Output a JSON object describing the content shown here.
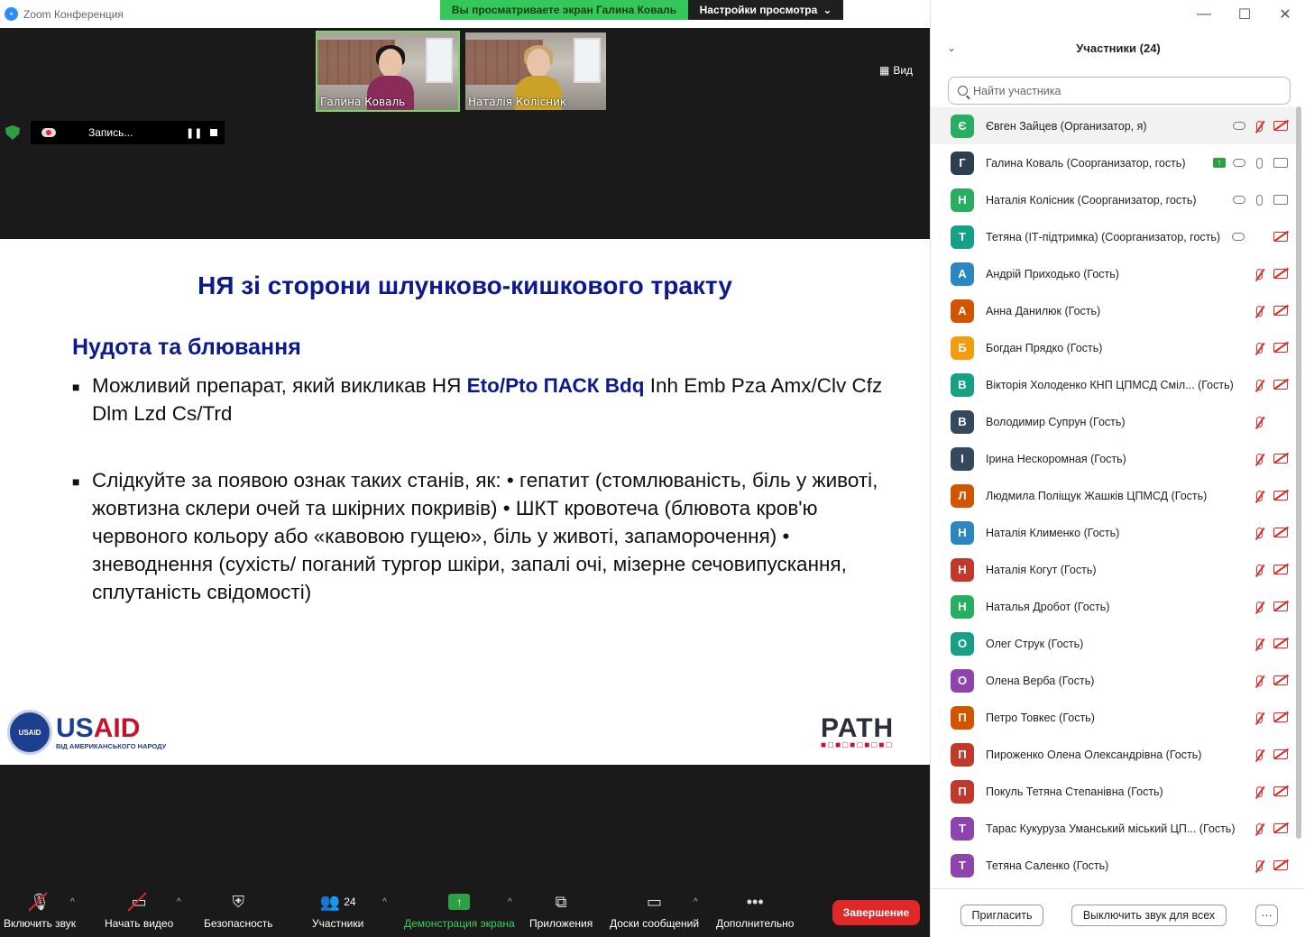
{
  "window": {
    "title": "Zoom Конференция"
  },
  "banner": {
    "sharing": "Вы просматриваете экран Галина Коваль",
    "view_settings": "Настройки просмотра"
  },
  "video": {
    "view_label": "Вид",
    "thumbs": [
      {
        "name": "Галина Коваль"
      },
      {
        "name": "Наталія Колісник"
      }
    ],
    "recording": {
      "label": "Запись..."
    }
  },
  "slide": {
    "title": "НЯ зі сторони шлунково-кишкового тракту",
    "subtitle": "Нудота та блювання",
    "bullet1_a": "Можливий препарат, який викликав НЯ ",
    "bullet1_b": "Eto/Pto ПАСК Bdq",
    "bullet1_c": " Inh Emb Pza Amx/Clv Cfz Dlm Lzd Cs/Trd",
    "bullet2": "Слідкуйте за появою ознак таких станів, як: • гепатит (стомлюваність, біль у животі, жовтизна склери очей та шкірних покривів) • ШКТ кровотеча (блювота кров'ю червоного кольору або «кавовою гущею», біль у животі, запаморочення) • зневоднення (сухість/ поганий тургор шкіри, запалі очі, мізерне сечовипускання, сплутаність свідомості)",
    "usaid_word_a": "US",
    "usaid_word_b": "AID",
    "usaid_seal": "USAID",
    "usaid_tagline": "ВІД АМЕРИКАНСЬКОГО НАРОДУ",
    "path_logo": "PATH"
  },
  "toolbar": {
    "unmute": "Включить звук",
    "start_video": "Начать видео",
    "security": "Безопасность",
    "participants": "Участники",
    "participants_count": "24",
    "share": "Демонстрация экрана",
    "apps": "Приложения",
    "whiteboards": "Доски сообщений",
    "more": "Дополнительно",
    "end": "Завершение"
  },
  "panel": {
    "title": "Участники (24)",
    "search_placeholder": "Найти участника",
    "invite": "Пригласить",
    "mute_all": "Выключить звук для всех",
    "more": "···",
    "participants": [
      {
        "initial": "Є",
        "color": "#27ae60",
        "name": "Євген Зайцев (Организатор, я)",
        "cloud": true,
        "share": false,
        "mic": "off",
        "cam": "off"
      },
      {
        "initial": "Г",
        "color": "#2c3e50",
        "name": "Галина Коваль (Соорганизатор, гость)",
        "cloud": true,
        "share": true,
        "mic": "on",
        "cam": "on"
      },
      {
        "initial": "Н",
        "color": "#27ae60",
        "name": "Наталія Колісник (Соорганизатор, гость)",
        "cloud": true,
        "share": false,
        "mic": "on",
        "cam": "on"
      },
      {
        "initial": "Т",
        "color": "#16a085",
        "name": "Тетяна (ІТ-підтримка) (Соорганизатор, гость)",
        "cloud": true,
        "share": false,
        "mic": "none",
        "cam": "off"
      },
      {
        "initial": "А",
        "color": "#2e86c1",
        "name": "Андрій Приходько (Гость)",
        "cloud": false,
        "share": false,
        "mic": "off",
        "cam": "off"
      },
      {
        "initial": "А",
        "color": "#d35400",
        "name": "Анна Данилюк (Гость)",
        "cloud": false,
        "share": false,
        "mic": "off",
        "cam": "off"
      },
      {
        "initial": "Б",
        "color": "#f39c12",
        "name": "Богдан Прядко (Гость)",
        "cloud": false,
        "share": false,
        "mic": "off",
        "cam": "off"
      },
      {
        "initial": "В",
        "color": "#16a085",
        "name": "Вікторія Холоденко КНП ЦПМСД Сміл... (Гость)",
        "cloud": false,
        "share": false,
        "mic": "off",
        "cam": "off"
      },
      {
        "initial": "В",
        "color": "#34495e",
        "name": "Володимир Супрун (Гость)",
        "cloud": false,
        "share": false,
        "mic": "off",
        "cam": "none"
      },
      {
        "initial": "І",
        "color": "#34495e",
        "name": "Ірина Нескоромная (Гость)",
        "cloud": false,
        "share": false,
        "mic": "off",
        "cam": "off"
      },
      {
        "initial": "Л",
        "color": "#d35400",
        "name": "Людмила Поліщук Жашків ЦПМСД (Гость)",
        "cloud": false,
        "share": false,
        "mic": "off",
        "cam": "off"
      },
      {
        "initial": "Н",
        "color": "#2e86c1",
        "name": "Наталія Клименко (Гость)",
        "cloud": false,
        "share": false,
        "mic": "off",
        "cam": "off"
      },
      {
        "initial": "Н",
        "color": "#c0392b",
        "name": "Наталія Когут (Гость)",
        "cloud": false,
        "share": false,
        "mic": "off",
        "cam": "off"
      },
      {
        "initial": "Н",
        "color": "#27ae60",
        "name": "Наталья Дробот (Гость)",
        "cloud": false,
        "share": false,
        "mic": "off",
        "cam": "off"
      },
      {
        "initial": "О",
        "color": "#16a085",
        "name": "Олег Струк (Гость)",
        "cloud": false,
        "share": false,
        "mic": "off",
        "cam": "off"
      },
      {
        "initial": "О",
        "color": "#8e44ad",
        "name": "Олена Верба (Гость)",
        "cloud": false,
        "share": false,
        "mic": "off",
        "cam": "off"
      },
      {
        "initial": "П",
        "color": "#d35400",
        "name": "Петро Товкес (Гость)",
        "cloud": false,
        "share": false,
        "mic": "off",
        "cam": "off"
      },
      {
        "initial": "П",
        "color": "#c0392b",
        "name": "Пироженко Олена Олександрівна (Гость)",
        "cloud": false,
        "share": false,
        "mic": "off",
        "cam": "off"
      },
      {
        "initial": "П",
        "color": "#c0392b",
        "name": "Покуль Тетяна Степанівна (Гость)",
        "cloud": false,
        "share": false,
        "mic": "off",
        "cam": "off"
      },
      {
        "initial": "Т",
        "color": "#8e44ad",
        "name": "Тарас Кукуруза Уманський міський ЦП... (Гость)",
        "cloud": false,
        "share": false,
        "mic": "off",
        "cam": "off"
      },
      {
        "initial": "Т",
        "color": "#8e44ad",
        "name": "Тетяна Саленко (Гость)",
        "cloud": false,
        "share": false,
        "mic": "off",
        "cam": "off"
      }
    ]
  }
}
